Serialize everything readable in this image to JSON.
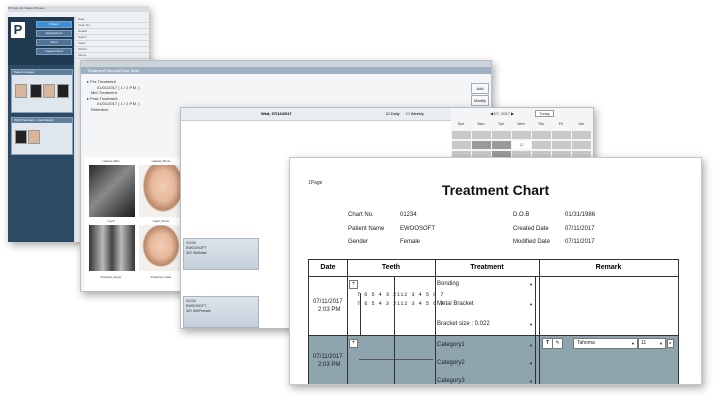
{
  "window1": {
    "title": "Orthodontic Station Planner",
    "logo": "P",
    "side_buttons": [
      "Patient",
      "Appointment",
      "Chart",
      "Image Import"
    ],
    "patients_header": "Patient Images",
    "panel2_header": "Print/Treatment - Case Result",
    "right_rows": [
      "Date",
      "Case No.",
      "Details",
      "Seach",
      "Insert",
      "Others",
      "Memo"
    ]
  },
  "window2": {
    "header": "Treatment Record/Case Note",
    "tree": [
      "Pre-Treatment",
      "01/01/2017 ( 1 / 2 P.M. )",
      "Mid-Treatment",
      "Post-Treatment",
      "01/01/2017 ( 1 / 2 P.M. )",
      "Retention"
    ],
    "buttons": [
      "Add",
      "Modify"
    ],
    "photo_labels": [
      "Lateral_Main",
      "Lateral_Photo",
      "Ceph",
      "Ceph_Photo",
      "Intraoral_Upper",
      "Intraoral_Lower"
    ]
  },
  "window3": {
    "date_label": "Wed, 07/12/2017",
    "check_daily": "Daily",
    "check_weekly": "Weekly",
    "patients": [
      {
        "id": "01234",
        "name": "EWOOSOFT",
        "info": "32Y 5M/Male"
      },
      {
        "id": "01234",
        "name": "EWOOSOFT",
        "info": "32Y 5M/Female"
      }
    ],
    "calendar": {
      "month": "07, 2017",
      "today": "Today",
      "days": [
        "Sun",
        "Mon",
        "Tue",
        "Wed",
        "Thu",
        "Fri",
        "Sat"
      ],
      "selected_day": "12"
    }
  },
  "chart": {
    "page": "1Page",
    "title": "Treatment Chart",
    "fields": {
      "chart_no_label": "Chart No.",
      "chart_no": "01234",
      "patient_name_label": "Patient Name",
      "patient_name": "EWOOSOFT",
      "gender_label": "Gender",
      "gender": "Female",
      "dob_label": "D.O.B",
      "dob": "01/31/1986",
      "created_label": "Created Date",
      "created": "07/11/2017",
      "modified_label": "Modified Date",
      "modified": "07/11/2017"
    },
    "columns": [
      "Date",
      "Teeth",
      "Treatment",
      "Remark"
    ],
    "rows": [
      {
        "date": "07/11/2017",
        "time": "2:03 PM",
        "teeth_upper_left": "7 6 5 4 3 2 1",
        "teeth_lower_left": "7 6 5 4 3 2 1",
        "teeth_upper_right": "1 2 3 4 5 6 7",
        "teeth_lower_right": "1 2 3 4 5 6 7",
        "treatments": [
          "Bonding",
          "Metal Bracket",
          "Bracket size : 0.022"
        ]
      },
      {
        "date": "07/11/2017",
        "time": "2:03 PM",
        "treatments": [
          "Category1",
          "Category2",
          "Category3"
        ],
        "font": "Tahoma",
        "font_size": "11"
      }
    ]
  }
}
